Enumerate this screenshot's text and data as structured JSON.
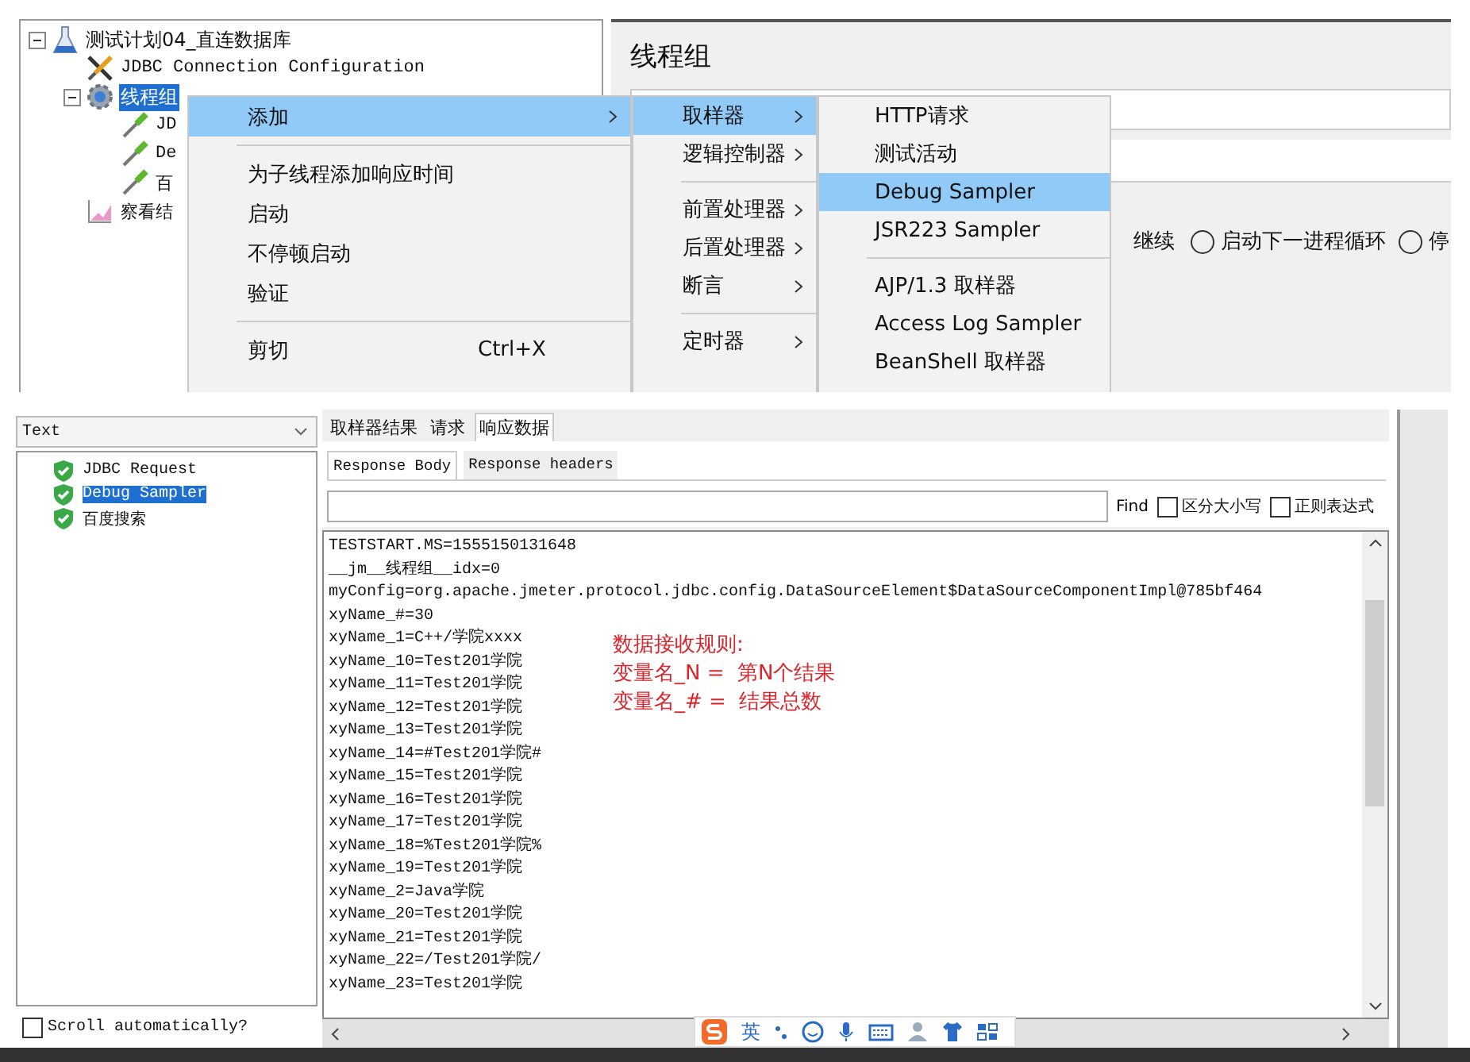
{
  "top": {
    "tree": [
      {
        "label": "测试计划04_直连数据库",
        "kind": "flask",
        "selected": false,
        "expanded": true,
        "children": [
          {
            "label": "JDBC Connection Configuration",
            "kind": "tools",
            "selected": false
          },
          {
            "label": "线程组",
            "kind": "gear",
            "selected": true,
            "expanded": true,
            "children": [
              {
                "label": "JD",
                "kind": "pipette",
                "selected": false
              },
              {
                "label": "De",
                "kind": "pipette",
                "selected": false
              },
              {
                "label": "百",
                "kind": "pipette",
                "selected": false
              }
            ]
          },
          {
            "label": "察看结",
            "kind": "chart",
            "selected": false
          }
        ]
      }
    ],
    "editor": {
      "title": "线程组",
      "radio_fragment": "继续",
      "radios": [
        {
          "label": "启动下一进程循环",
          "selected": false
        },
        {
          "label": "停",
          "selected": false
        }
      ]
    },
    "context_menu": [
      {
        "kind": "item",
        "label": "添加",
        "submenu": true,
        "selected": true
      },
      {
        "kind": "separator"
      },
      {
        "kind": "item",
        "label": "为子线程添加响应时间",
        "submenu": false,
        "selected": false
      },
      {
        "kind": "item",
        "label": "启动",
        "submenu": false,
        "selected": false
      },
      {
        "kind": "item",
        "label": "不停顿启动",
        "submenu": false,
        "selected": false
      },
      {
        "kind": "item",
        "label": "验证",
        "submenu": false,
        "selected": false
      },
      {
        "kind": "separator"
      },
      {
        "kind": "item",
        "label": "剪切",
        "shortcut": "Ctrl+X",
        "submenu": false,
        "selected": false
      }
    ],
    "add_menu": [
      {
        "kind": "item",
        "label": "取样器",
        "submenu": true,
        "selected": true
      },
      {
        "kind": "item",
        "label": "逻辑控制器",
        "submenu": true,
        "selected": false
      },
      {
        "kind": "separator"
      },
      {
        "kind": "item",
        "label": "前置处理器",
        "submenu": true,
        "selected": false
      },
      {
        "kind": "item",
        "label": "后置处理器",
        "submenu": true,
        "selected": false
      },
      {
        "kind": "item",
        "label": "断言",
        "submenu": true,
        "selected": false
      },
      {
        "kind": "separator"
      },
      {
        "kind": "item",
        "label": "定时器",
        "submenu": true,
        "selected": false
      }
    ],
    "sampler_menu": [
      {
        "kind": "item",
        "label": "HTTP请求",
        "selected": false
      },
      {
        "kind": "item",
        "label": "测试活动",
        "selected": false
      },
      {
        "kind": "item",
        "label": "Debug Sampler",
        "selected": true
      },
      {
        "kind": "item",
        "label": "JSR223 Sampler",
        "selected": false
      },
      {
        "kind": "separator"
      },
      {
        "kind": "item",
        "label": "AJP/1.3 取样器",
        "selected": false
      },
      {
        "kind": "item",
        "label": "Access Log Sampler",
        "selected": false
      },
      {
        "kind": "item",
        "label": "BeanShell 取样器",
        "selected": false
      }
    ]
  },
  "bottom": {
    "renderer": "Text",
    "results": [
      {
        "label": "JDBC Request",
        "selected": false
      },
      {
        "label": "Debug Sampler",
        "selected": true
      },
      {
        "label": "百度搜索",
        "selected": false
      }
    ],
    "scroll_automatically": {
      "label": "Scroll automatically?",
      "checked": false
    },
    "tabs": [
      {
        "label": "取样器结果",
        "selected": false
      },
      {
        "label": "请求",
        "selected": false
      },
      {
        "label": "响应数据",
        "selected": true
      }
    ],
    "subtabs": [
      {
        "label": "Response Body",
        "selected": true
      },
      {
        "label": "Response headers",
        "selected": false
      }
    ],
    "find": {
      "button": "Find",
      "options": [
        {
          "label": "区分大小写",
          "checked": false
        },
        {
          "label": "正则表达式",
          "checked": false
        }
      ]
    },
    "lines": [
      "TESTSTART.MS=1555150131648",
      "__jm__线程组__idx=0",
      "myConfig=org.apache.jmeter.protocol.jdbc.config.DataSourceElement$DataSourceComponentImpl@785bf464",
      "xyName_#=30",
      "xyName_1=C++/学院xxxx",
      "xyName_10=Test201学院",
      "xyName_11=Test201学院",
      "xyName_12=Test201学院",
      "xyName_13=Test201学院",
      "xyName_14=#Test201学院#",
      "xyName_15=Test201学院",
      "xyName_16=Test201学院",
      "xyName_17=Test201学院",
      "xyName_18=%Test201学院%",
      "xyName_19=Test201学院",
      "xyName_2=Java学院",
      "xyName_20=Test201学院",
      "xyName_21=Test201学院",
      "xyName_22=/Test201学院/",
      "xyName_23=Test201学院"
    ],
    "annotation": [
      "数据接收规则:",
      "变量名_N =  第N个结果",
      "变量名_# =  结果总数"
    ],
    "ime_toolbar": {
      "mode": "英"
    }
  }
}
